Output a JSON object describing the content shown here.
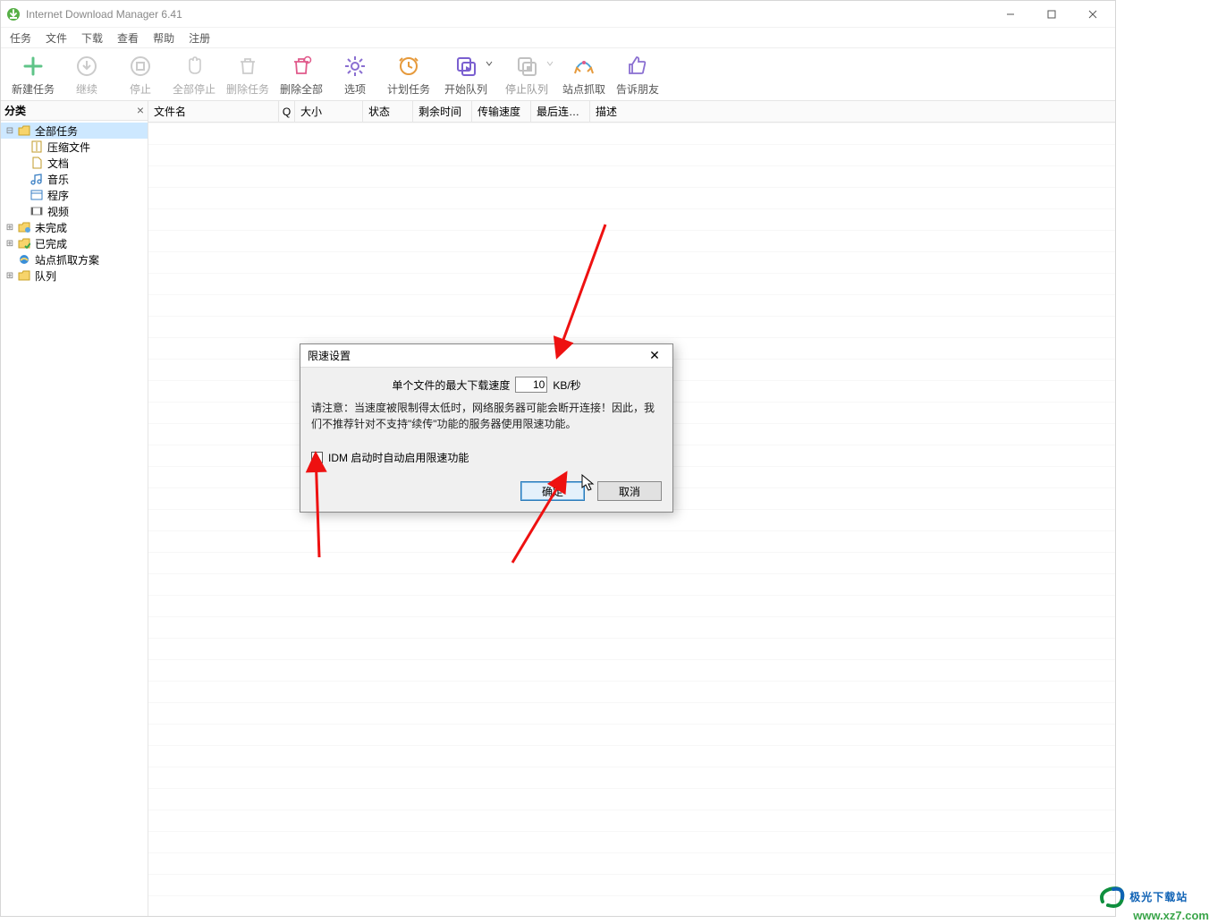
{
  "title": "Internet Download Manager 6.41",
  "menu": {
    "tasks": "任务",
    "file": "文件",
    "download": "下载",
    "view": "查看",
    "help": "帮助",
    "register": "注册"
  },
  "toolbar": {
    "new": "新建任务",
    "resume": "继续",
    "stop": "停止",
    "stopAll": "全部停止",
    "delete": "删除任务",
    "deleteAll": "删除全部",
    "options": "选项",
    "scheduler": "计划任务",
    "startQueue": "开始队列",
    "stopQueue": "停止队列",
    "grabber": "站点抓取",
    "tell": "告诉朋友"
  },
  "sidebar": {
    "header": "分类",
    "items": {
      "all": "全部任务",
      "archive": "压缩文件",
      "docs": "文档",
      "music": "音乐",
      "apps": "程序",
      "video": "视频",
      "unfinished": "未完成",
      "finished": "已完成",
      "grabbed": "站点抓取方案",
      "queue": "队列"
    }
  },
  "columns": {
    "filename": "文件名",
    "q": "Q",
    "size": "大小",
    "status": "状态",
    "timeleft": "剩余时间",
    "speed": "传输速度",
    "lastTry": "最后连…",
    "desc": "描述"
  },
  "dialog": {
    "title": "限速设置",
    "maxLabel": "单个文件的最大下载速度",
    "maxValue": "10",
    "unit": "KB/秒",
    "warn": "请注意：当速度被限制得太低时，网络服务器可能会断开连接！因此，我们不推荐针对不支持\"续传\"功能的服务器使用限速功能。",
    "checkbox": "IDM 启动时自动启用限速功能",
    "ok": "确定",
    "cancel": "取消"
  },
  "watermark": {
    "brand": "极光下载站",
    "url": "www.xz7.com"
  }
}
